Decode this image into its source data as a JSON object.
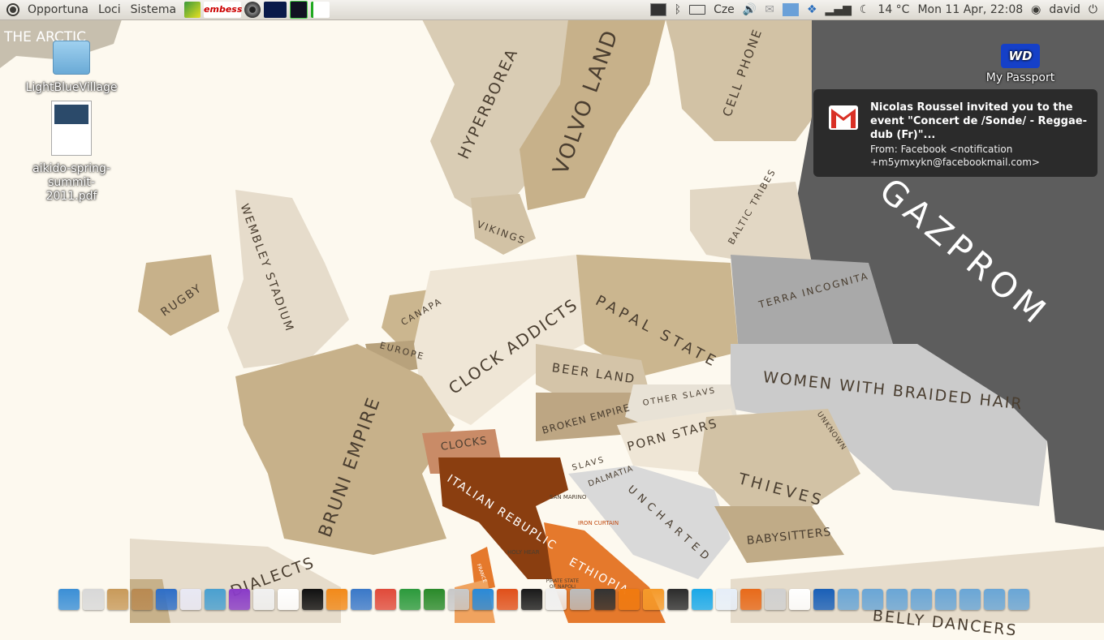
{
  "panel": {
    "menus": [
      "Opportuna",
      "Loci",
      "Sistema"
    ],
    "keyboard_layout": "Cze",
    "temperature": "14 °C",
    "datetime": "Mon 11 Apr, 22:08",
    "user": "david",
    "launcher_icons": [
      "app-icon",
      "embess-icon",
      "disc-icon",
      "terminal-graph-icon",
      "tree-icon",
      "tree-icon-2"
    ]
  },
  "desktop": {
    "icons": [
      {
        "label": "LightBlueVillage",
        "type": "folder"
      },
      {
        "label": "aikido-spring-summit-2011.pdf",
        "type": "pdf"
      },
      {
        "label": "My Passport",
        "type": "drive"
      }
    ]
  },
  "notification": {
    "title": "Nicolas Roussel invited you to the event \"Concert de /Sonde/ - Reggae-dub (Fr)\"...",
    "body": "From: Facebook <notification +m5ymxykn@facebookmail.com>"
  },
  "map_labels": {
    "arctic": "THE ARCTIC",
    "hyperborea": "HYPERBOREA",
    "volvo": "VOLVO LAND",
    "cellphone": "CELL PHONE",
    "gazprom": "GAZPROM",
    "vikings": "VIKINGS",
    "baltic": "BALTIC TRIBES",
    "wembley": "WEMBLEY STADIUM",
    "rugby": "RUGBY",
    "canapa": "CANAPA",
    "europe": "EUROPE",
    "clock_addicts": "CLOCK ADDICTS",
    "papal": "PAPAL STATE",
    "terra": "TERRA INCOGNITA",
    "beer": "BEER LAND",
    "women": "WOMEN WITH BRAIDED HAIR",
    "other_slavs": "OTHER SLAVS",
    "bruni": "BRUNI EMPIRE",
    "broken": "BROKEN EMPIRE",
    "unknown": "UNKNOWN",
    "clocks": "CLOCKS",
    "porn": "PORN STARS",
    "slavs": "SLAVS",
    "thieves": "THIEVES",
    "italian": "ITALIAN REBUPLIC",
    "dalmatia": "DALMATIA",
    "uncharted": "UNCHARTED",
    "san_marino": "SAN MARINO",
    "iron_curtain": "IRON CURTAIN",
    "babysitters": "BABYSITTERS",
    "france": "FRANCE",
    "holy": "HOLY HEAR",
    "ethiopia": "ETHIOPIA",
    "dialects": "DIALECTS",
    "pirate": "PIRATE STATE OF NAPOLI",
    "belly": "BELLY DANCERS"
  },
  "colors": {
    "sea": "#fdf9ef",
    "panel": "#dcd8d0",
    "notification_bg": "#282828",
    "gazprom": "#5d5d5d",
    "italy": "#8a3e10",
    "ethiopia": "#e5792c"
  },
  "dock": {
    "icons": [
      "anchor-icon",
      "file-manager-icon",
      "archive-icon",
      "package-icon",
      "music-icon",
      "graph-icon",
      "paint-icon",
      "bird-icon",
      "inkscape-icon",
      "pen-icon",
      "photo-icon",
      "blender-icon",
      "document-icon",
      "chart-icon",
      "spreadsheet-icon",
      "vim-icon",
      "usb-icon",
      "monitor-icon",
      "box-icon",
      "bug-icon",
      "pencil-icon",
      "keyboard-icon",
      "disc-icon",
      "vlc-icon",
      "orange-icon",
      "terminal-icon",
      "skype-icon",
      "chat-icon",
      "firefox-icon",
      "trash-icon",
      "gmail-icon",
      "display-icon",
      "folder-icon",
      "folder-icon",
      "folder-icon",
      "folder-icon",
      "folder-icon",
      "folder-icon",
      "folder-icon",
      "folder-icon"
    ]
  }
}
